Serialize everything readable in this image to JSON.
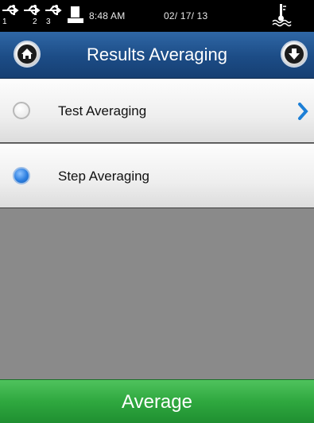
{
  "status_bar": {
    "usb_ports": [
      "1",
      "2",
      "3"
    ],
    "time": "8:48 AM",
    "date": "02/ 17/ 13",
    "icons": [
      "usb-icon",
      "printer-icon",
      "thermometer-icon"
    ]
  },
  "header": {
    "title": "Results Averaging",
    "home_icon": "home-icon",
    "down_icon": "down-arrow-icon"
  },
  "options": [
    {
      "label": "Test Averaging",
      "selected": false,
      "has_submenu": true
    },
    {
      "label": "Step Averaging",
      "selected": true,
      "has_submenu": false
    }
  ],
  "bottom_button": {
    "label": "Average"
  },
  "colors": {
    "header_blue": "#1c4c86",
    "radio_selected": "#2d7fe0",
    "chevron_blue": "#1d7fd6",
    "bottom_green": "#2fa83f",
    "background_gray": "#8a8a8a"
  }
}
